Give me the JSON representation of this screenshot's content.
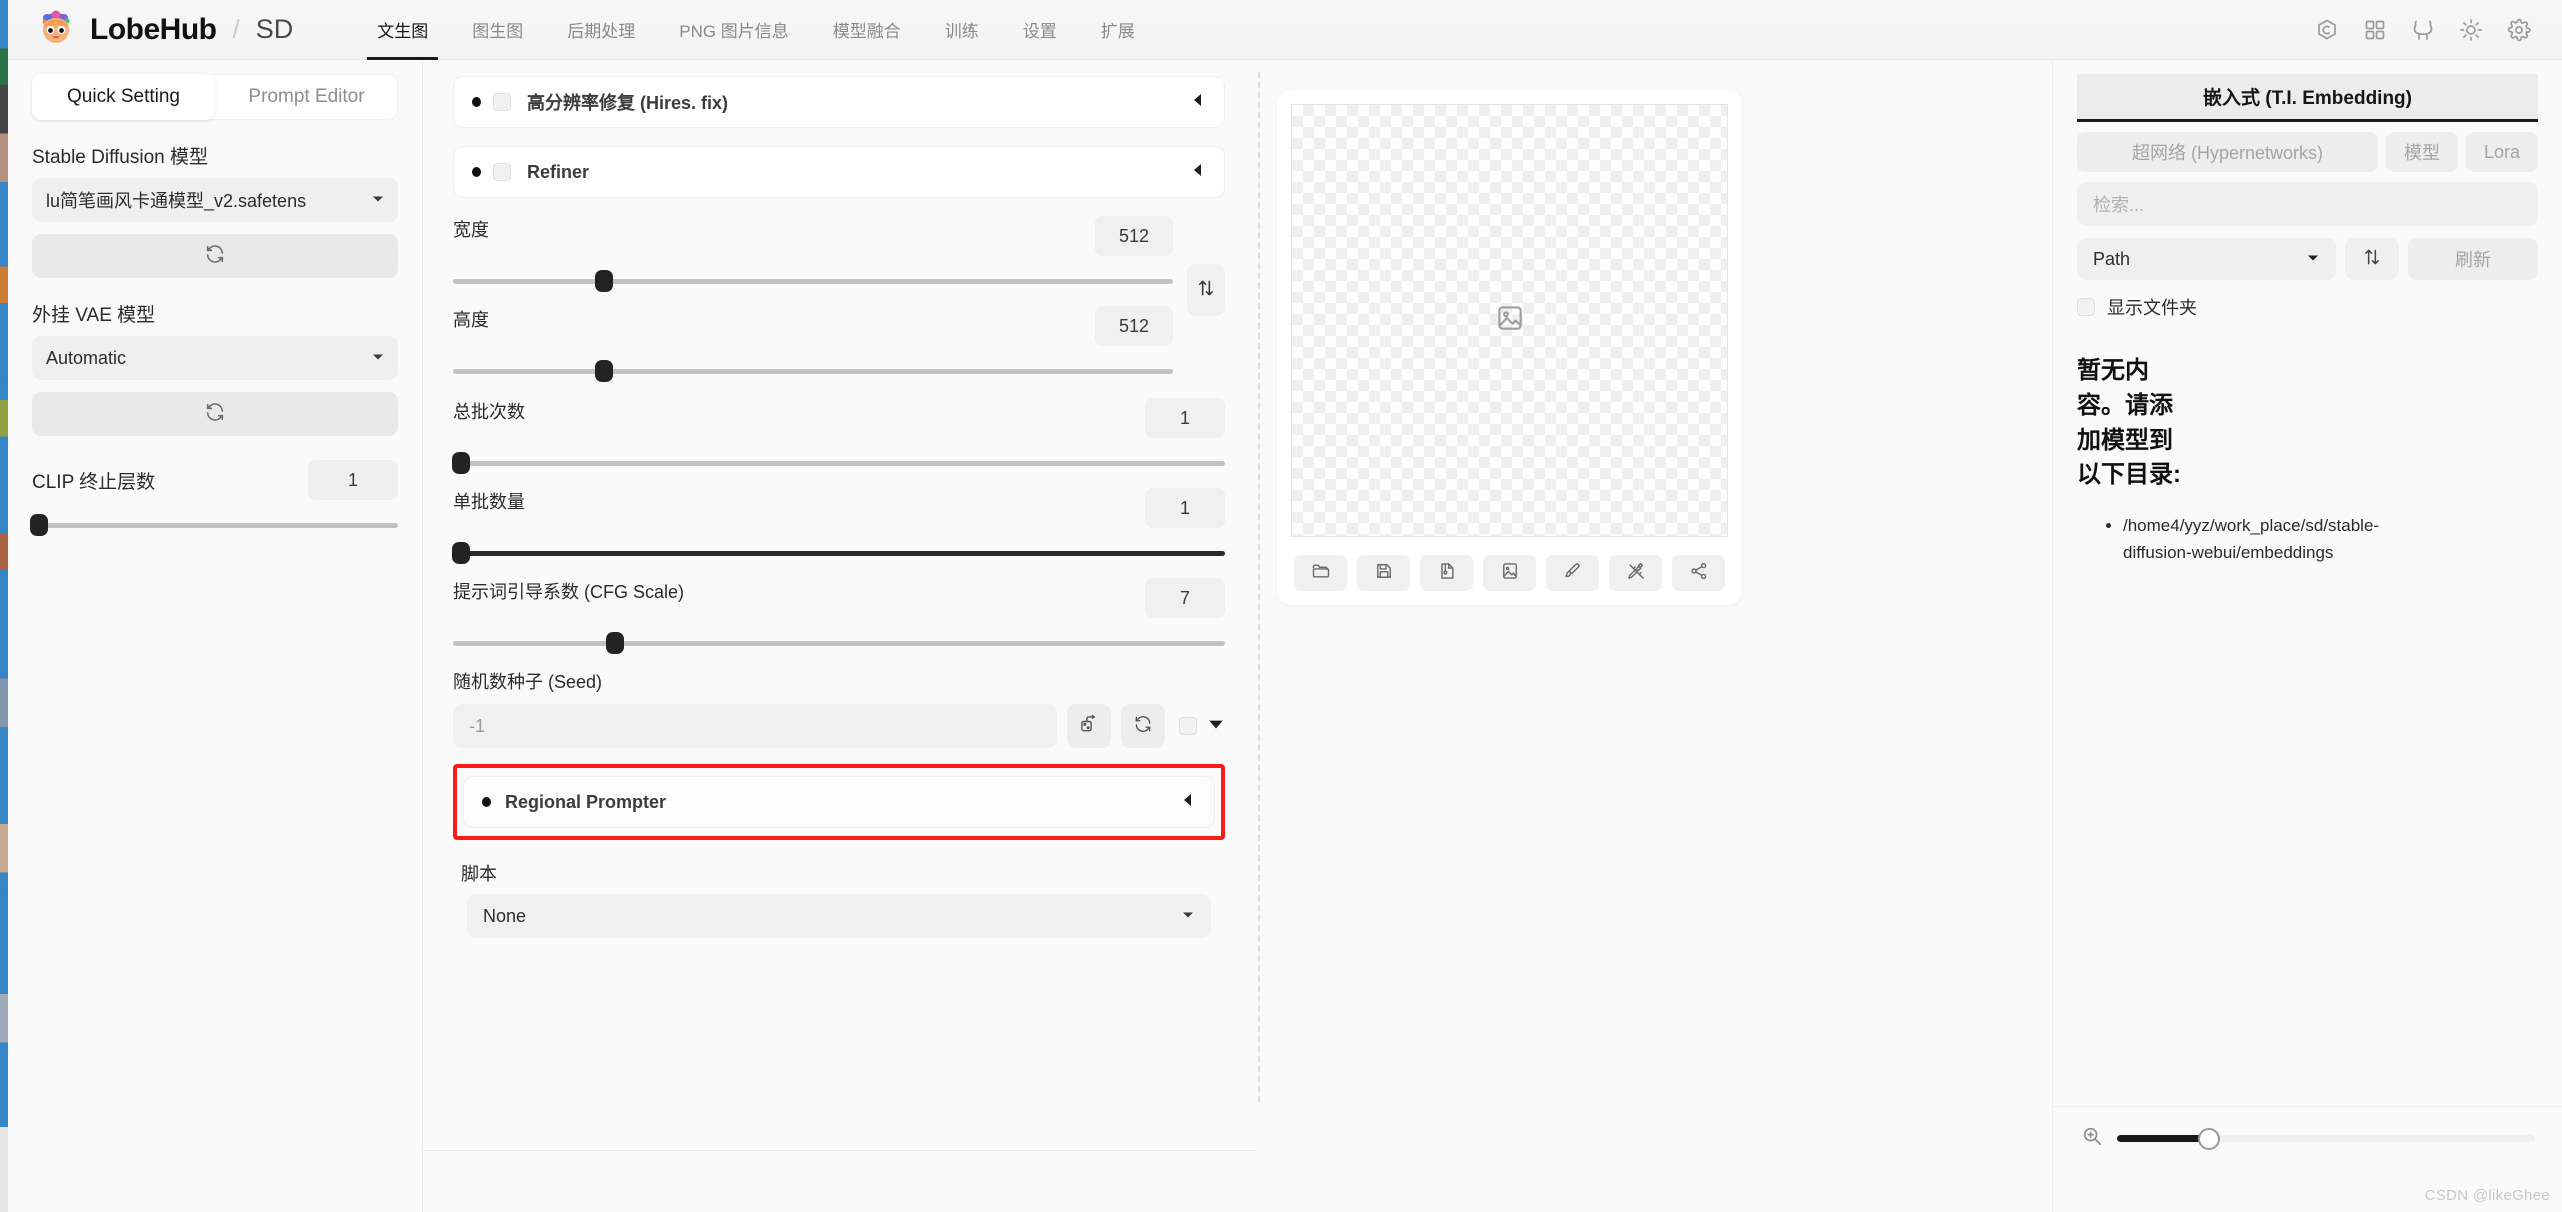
{
  "header": {
    "brand": "LobeHub",
    "separator": "/",
    "sub": "SD",
    "logo_icon": "lobehub-avatar-icon",
    "tabs": [
      {
        "label": "文生图",
        "active": true
      },
      {
        "label": "图生图",
        "active": false
      },
      {
        "label": "后期处理",
        "active": false
      },
      {
        "label": "PNG 图片信息",
        "active": false
      },
      {
        "label": "模型融合",
        "active": false
      },
      {
        "label": "训练",
        "active": false
      },
      {
        "label": "设置",
        "active": false
      },
      {
        "label": "扩展",
        "active": false
      }
    ],
    "actions": [
      {
        "icon": "hexagon-badge-icon"
      },
      {
        "icon": "grid-apps-icon"
      },
      {
        "icon": "github-icon"
      },
      {
        "icon": "sun-theme-icon"
      },
      {
        "icon": "gear-settings-icon"
      }
    ]
  },
  "sidebar": {
    "segments": [
      {
        "label": "Quick Setting",
        "active": true
      },
      {
        "label": "Prompt Editor",
        "active": false
      }
    ],
    "sd_model": {
      "label": "Stable Diffusion 模型",
      "value": "lu简笔画风卡通模型_v2.safetens",
      "refresh_icon": "refresh-icon"
    },
    "vae_model": {
      "label": "外挂 VAE 模型",
      "value": "Automatic",
      "refresh_icon": "refresh-icon"
    },
    "clip": {
      "label": "CLIP 终止层数",
      "value": "1",
      "slider_percent": 2
    }
  },
  "center": {
    "accordions": [
      {
        "label": "高分辨率修复 (Hires. fix)",
        "has_checkbox": true,
        "collapse_icon": "triangle-left-icon"
      },
      {
        "label": "Refiner",
        "has_checkbox": true,
        "collapse_icon": "triangle-left-icon"
      }
    ],
    "width": {
      "label": "宽度",
      "value": "512",
      "slider_percent": 21
    },
    "height": {
      "label": "高度",
      "value": "512",
      "slider_percent": 21
    },
    "swap_icon": "swap-vertical-icon",
    "batch_count": {
      "label": "总批次数",
      "value": "1",
      "slider_percent": 1
    },
    "batch_size": {
      "label": "单批数量",
      "value": "1",
      "slider_percent": 1
    },
    "cfg": {
      "label": "提示词引导系数 (CFG Scale)",
      "value": "7",
      "slider_percent": 21
    },
    "seed": {
      "label": "随机数种子 (Seed)",
      "value": "-1",
      "dice_icon": "dice-icon",
      "recycle_icon": "recycle-icon",
      "expand_icon": "triangle-down-icon"
    },
    "regional_prompter": {
      "label": "Regional Prompter",
      "collapse_icon": "triangle-left-icon",
      "highlight_color": "#fc1a14"
    },
    "script": {
      "label": "脚本",
      "value": "None"
    }
  },
  "preview": {
    "placeholder_icon": "image-placeholder-icon",
    "toolbar": [
      {
        "icon": "folder-open-icon"
      },
      {
        "icon": "save-floppy-icon"
      },
      {
        "icon": "file-zip-icon"
      },
      {
        "icon": "send-to-image-icon"
      },
      {
        "icon": "paint-brush-icon"
      },
      {
        "icon": "pen-ruler-icon"
      },
      {
        "icon": "share-icon"
      }
    ]
  },
  "rightbar": {
    "active_tab": "嵌入式 (T.I. Embedding)",
    "tabs": [
      {
        "label": "超网络 (Hypernetworks)"
      },
      {
        "label": "模型"
      },
      {
        "label": "Lora"
      }
    ],
    "search_placeholder": "检索...",
    "sort_select": "Path",
    "sort_icon": "sort-updown-icon",
    "refresh_label": "刷新",
    "show_folder_label": "显示文件夹",
    "empty_text": "暂无内容。请添加模型到以下目录:",
    "paths": [
      "/home4/yyz/work_place/sd/stable-diffusion-webui/embeddings"
    ],
    "zoom_icon": "zoom-in-icon",
    "zoom_percent": 22
  },
  "watermark": "CSDN @likeGhee"
}
